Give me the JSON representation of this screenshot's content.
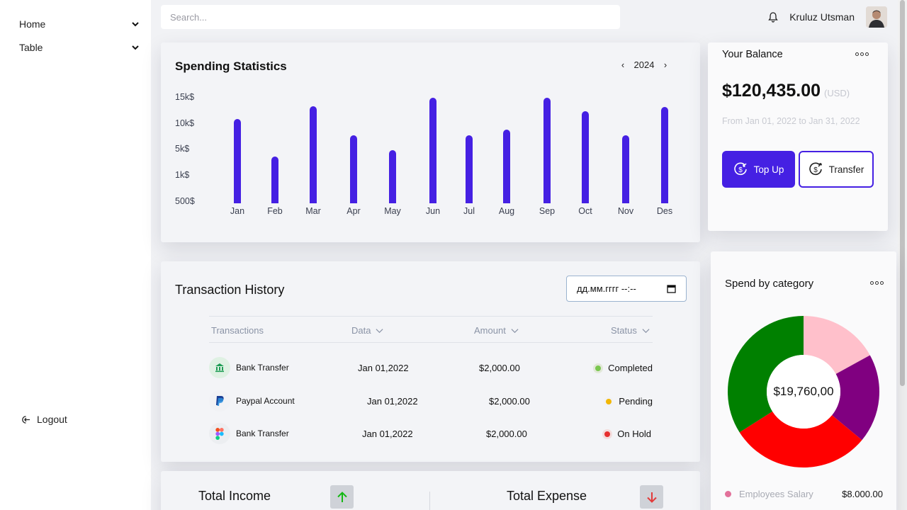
{
  "sidebar": {
    "items": [
      {
        "label": "Home"
      },
      {
        "label": "Table"
      }
    ],
    "logout_label": "Logout"
  },
  "search": {
    "placeholder": "Search..."
  },
  "user": {
    "name": "Kruluz Utsman"
  },
  "spending": {
    "title": "Spending Statistics",
    "year": "2024"
  },
  "chart_data": {
    "type": "bar",
    "title": "Spending Statistics",
    "categories": [
      "Jan",
      "Feb",
      "Mar",
      "Apr",
      "May",
      "Jun",
      "Jul",
      "Aug",
      "Sep",
      "Oct",
      "Nov",
      "Des"
    ],
    "y_tick_labels": [
      "15k$",
      "10k$",
      "5k$",
      "1k$",
      "500$"
    ],
    "values": [
      11900,
      6600,
      13700,
      9600,
      7500,
      14900,
      9600,
      10400,
      14900,
      13000,
      9600,
      13600
    ],
    "color": "#4520e3",
    "grid": false
  },
  "balance": {
    "title": "Your Balance",
    "amount": "$120,435.00",
    "currency": "(USD)",
    "range": "From Jan 01, 2022 to Jan 31, 2022",
    "topup_label": "Top Up",
    "transfer_label": "Transfer"
  },
  "transactions": {
    "title": "Transaction History",
    "date_placeholder": "дд.мм.гггг --:--",
    "columns": [
      "Transactions",
      "Data",
      "Amount",
      "Status"
    ],
    "rows": [
      {
        "name": "Bank Transfer",
        "date": "Jan 01,2022",
        "amount": "$2,000.00",
        "status": "Completed",
        "status_color": "#7ac74f",
        "icon": "bank-icon"
      },
      {
        "name": "Paypal Account",
        "date": "Jan 01,2022",
        "amount": "$2,000.00",
        "status": "Pending",
        "status_color": "#f2b705",
        "icon": "paypal-icon"
      },
      {
        "name": "Bank Transfer",
        "date": "Jan 01,2022",
        "amount": "$2,000.00",
        "status": "On Hold",
        "status_color": "#e62e2e",
        "icon": "figma-icon"
      }
    ]
  },
  "totals": {
    "income_label": "Total Income",
    "expense_label": "Total Expense"
  },
  "category": {
    "title": "Spend by category",
    "center_value": "$19,760,00",
    "slices": [
      {
        "color": "#ffc0cb",
        "value": 17
      },
      {
        "color": "#800080",
        "value": 19
      },
      {
        "color": "#ff0000",
        "value": 30
      },
      {
        "color": "#008000",
        "value": 34
      }
    ],
    "legend": [
      {
        "label": "Employees Salary",
        "value": "$8.000.00",
        "color": "#e2719a"
      }
    ]
  },
  "colors": {
    "accent": "#4520e3"
  }
}
